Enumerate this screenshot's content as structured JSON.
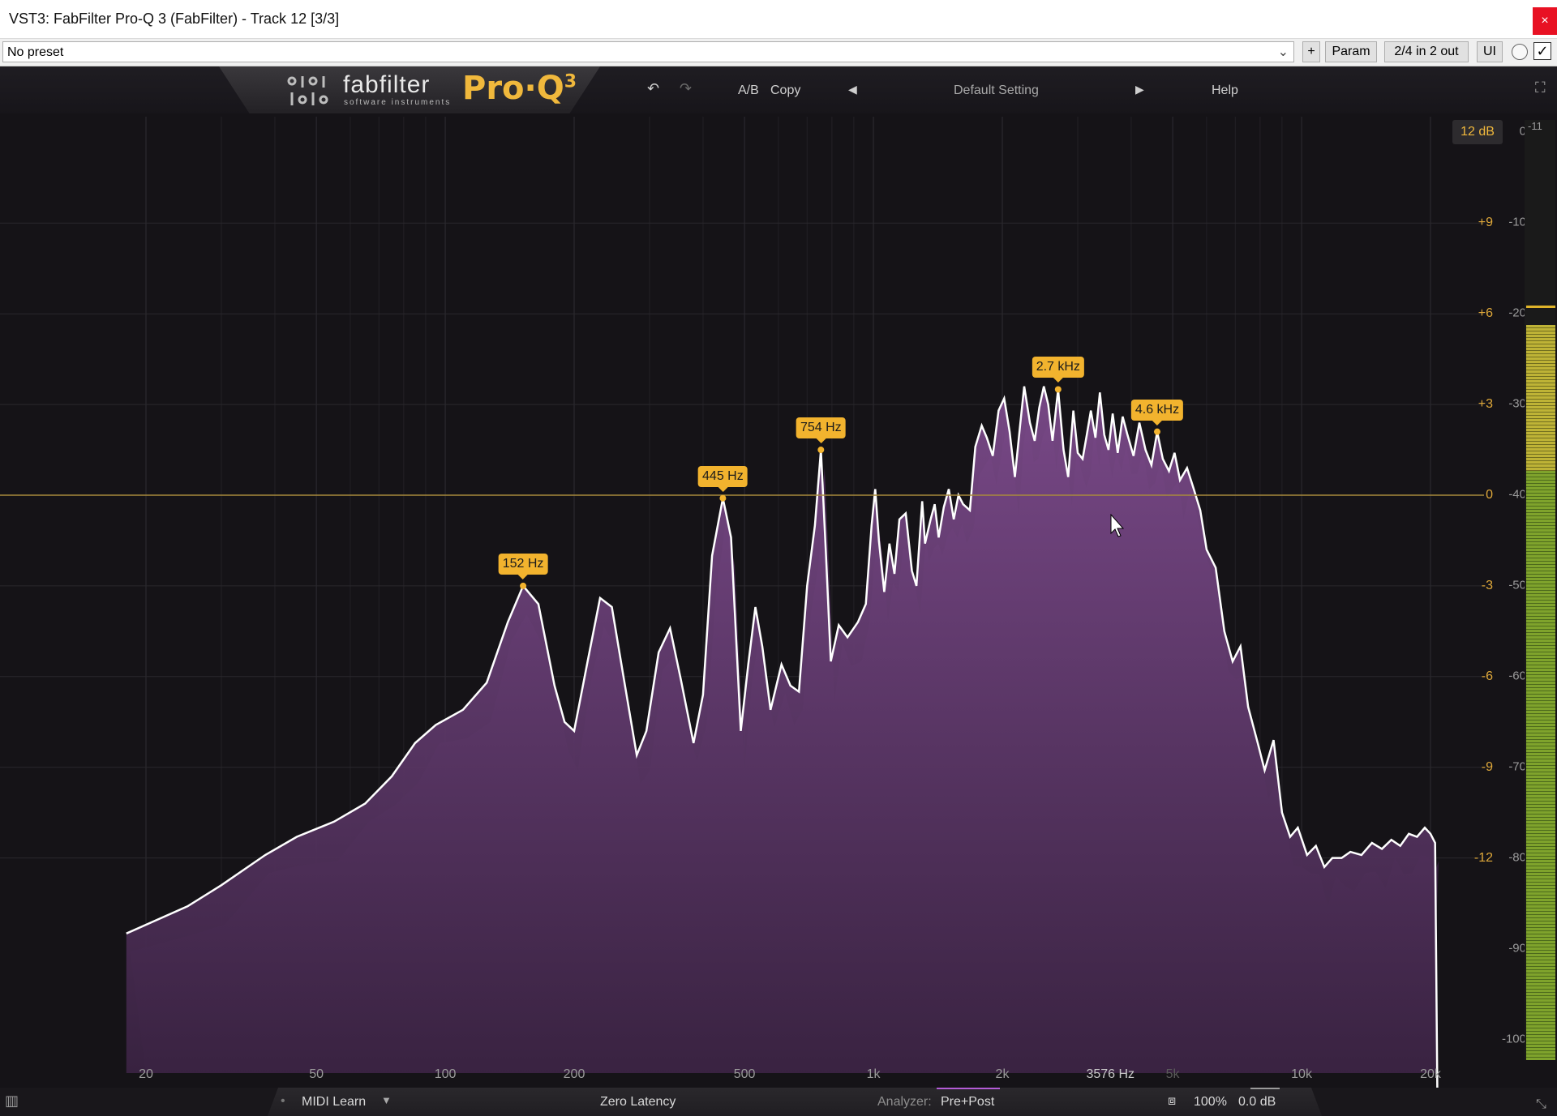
{
  "window": {
    "title": "VST3: FabFilter Pro-Q 3 (FabFilter) - Track 12 [3/3]",
    "close_glyph": "×"
  },
  "toolbar": {
    "preset_value": "No preset",
    "plus_label": "+",
    "param_label": "Param",
    "io_label": "2/4 in 2 out",
    "ui_label": "UI",
    "bypass_glyph": "✓"
  },
  "header": {
    "brand": "fabfilter",
    "brand_sub": "software instruments",
    "product": "Pro·Q",
    "product_version": "3",
    "ab_label": "A/B",
    "copy_label": "Copy",
    "preset_name": "Default Setting",
    "help_label": "Help",
    "db_range": "12 dB"
  },
  "gain_scale": [
    "+9",
    "+6",
    "+3",
    "0",
    "-3",
    "-6",
    "-9",
    "-12"
  ],
  "spectrum_scale": [
    "0",
    "-10",
    "-20",
    "-30",
    "-40",
    "-50",
    "-60",
    "-70",
    "-80",
    "-90",
    "-100"
  ],
  "meter_top": "-11",
  "frequency_scale": [
    "20",
    "50",
    "100",
    "200",
    "500",
    "1k",
    "2k",
    "3576 Hz",
    "5k",
    "10k",
    "20k"
  ],
  "peaks": [
    {
      "label": "152 Hz",
      "freq_hz": 152
    },
    {
      "label": "445 Hz",
      "freq_hz": 445
    },
    {
      "label": "754 Hz",
      "freq_hz": 754
    },
    {
      "label": "2.7 kHz",
      "freq_hz": 2700
    },
    {
      "label": "4.6 kHz",
      "freq_hz": 4600
    }
  ],
  "bottom": {
    "midi_learn": "MIDI Learn",
    "latency": "Zero Latency",
    "analyzer_label": "Analyzer:",
    "analyzer_value": "Pre+Post",
    "zoom": "100%",
    "output_gain": "0.0 dB"
  },
  "colors": {
    "accent": "#f2b32e",
    "spectrum_fill": "#6a3f78",
    "spectrum_line": "#ffffff",
    "background": "#151317"
  }
}
